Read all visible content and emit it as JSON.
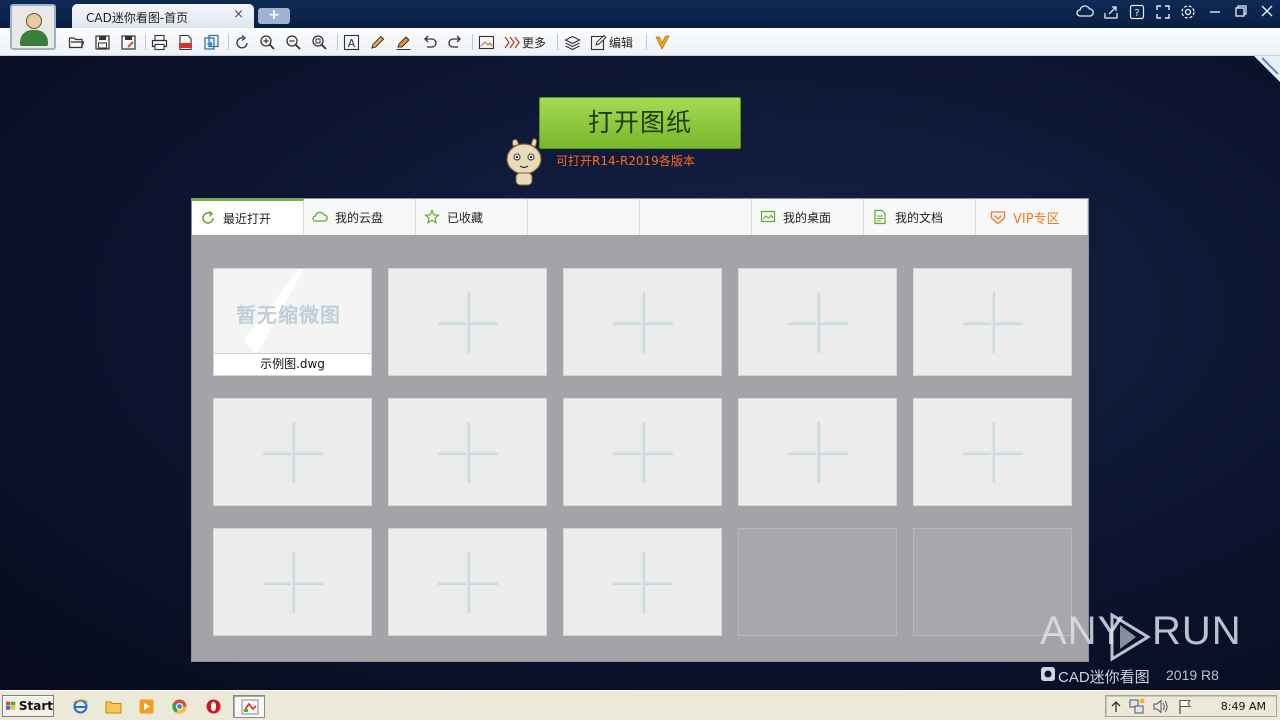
{
  "window": {
    "tab_title": "CAD迷你看图-首页",
    "tab_close": "×",
    "new_tab": "+"
  },
  "titlebar_icons": [
    "cloud-icon",
    "share-icon",
    "help-icon",
    "fullscreen-icon",
    "settings-icon",
    "minimize-icon",
    "restore-icon",
    "close-icon"
  ],
  "toolbar": {
    "more_label": "更多",
    "edit_label": "编辑"
  },
  "open_button": {
    "label": "打开图纸",
    "hint": "可打开R14-R2019各版本"
  },
  "file_tabs": {
    "recent": "最近打开",
    "cloud": "我的云盘",
    "favorites": "已收藏",
    "desktop": "我的桌面",
    "documents": "我的文档",
    "vip": "VIP专区"
  },
  "recent_files": {
    "sample_thumbnail_text": "暂无缩微图",
    "sample_filename": "示例图.dwg"
  },
  "brand": {
    "any": "ANY",
    "run": "RUN",
    "product": "CAD迷你看图",
    "version": "2019 R8"
  },
  "taskbar": {
    "start_label": "Start",
    "clock": "8:49 AM"
  },
  "colors": {
    "accent_green": "#78b72d",
    "vip_orange": "#f07a24",
    "hint_orange": "#ff6a1c"
  }
}
